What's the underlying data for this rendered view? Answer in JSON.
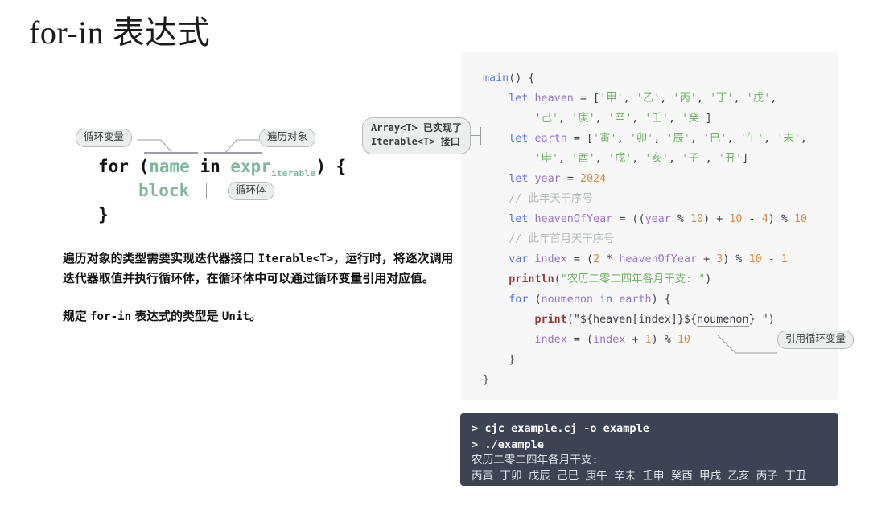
{
  "title": "for-in 表达式",
  "syntax_diagram": {
    "labels": {
      "loop_variable": "循环变量",
      "iteration_object": "遍历对象",
      "loop_body": "循环体"
    },
    "lines": {
      "for_prefix": "for (",
      "name_placeholder": "name",
      "in_keyword": " in ",
      "expr_placeholder": "expr",
      "expr_subscript": "iterable",
      "for_suffix": ") {",
      "block_placeholder": "block",
      "closing_brace": "}"
    }
  },
  "prose": {
    "paragraph1_a": "遍历对象的类型需要实现迭代器接口 ",
    "paragraph1_code": "Iterable<T>",
    "paragraph1_b": "，运行时，将逐次调用迭代器取值并执行循环体，在循环体中可以通过循环变量引用对应值。",
    "paragraph2_a": "规定 ",
    "paragraph2_code1": "for-in",
    "paragraph2_b": " 表达式的类型是 ",
    "paragraph2_code2": "Unit",
    "paragraph2_c": "。"
  },
  "callouts": {
    "array_line1": "Array<T> 已实现了",
    "array_line2": "Iterable<T> 接口",
    "reference_loop_variable": "引用循环变量"
  },
  "code": {
    "lines": [
      {
        "tokens": [
          {
            "t": "main",
            "c": "k-fn"
          },
          {
            "t": "() {",
            "c": "k-plain"
          }
        ]
      },
      {
        "tokens": [
          {
            "t": "    ",
            "c": "k-plain"
          },
          {
            "t": "let",
            "c": "k-kw"
          },
          {
            "t": " ",
            "c": "k-plain"
          },
          {
            "t": "heaven",
            "c": "k-var"
          },
          {
            "t": " = [",
            "c": "k-plain"
          },
          {
            "t": "'甲'",
            "c": "k-str"
          },
          {
            "t": ", ",
            "c": "k-plain"
          },
          {
            "t": "'乙'",
            "c": "k-str"
          },
          {
            "t": ", ",
            "c": "k-plain"
          },
          {
            "t": "'丙'",
            "c": "k-str"
          },
          {
            "t": ", ",
            "c": "k-plain"
          },
          {
            "t": "'丁'",
            "c": "k-str"
          },
          {
            "t": ", ",
            "c": "k-plain"
          },
          {
            "t": "'戊'",
            "c": "k-str"
          },
          {
            "t": ",",
            "c": "k-plain"
          }
        ]
      },
      {
        "tokens": [
          {
            "t": "        ",
            "c": "k-plain"
          },
          {
            "t": "'己'",
            "c": "k-str"
          },
          {
            "t": ", ",
            "c": "k-plain"
          },
          {
            "t": "'庚'",
            "c": "k-str"
          },
          {
            "t": ", ",
            "c": "k-plain"
          },
          {
            "t": "'辛'",
            "c": "k-str"
          },
          {
            "t": ", ",
            "c": "k-plain"
          },
          {
            "t": "'壬'",
            "c": "k-str"
          },
          {
            "t": ", ",
            "c": "k-plain"
          },
          {
            "t": "'癸'",
            "c": "k-str"
          },
          {
            "t": "]",
            "c": "k-plain"
          }
        ]
      },
      {
        "tokens": [
          {
            "t": "    ",
            "c": "k-plain"
          },
          {
            "t": "let",
            "c": "k-kw"
          },
          {
            "t": " ",
            "c": "k-plain"
          },
          {
            "t": "earth",
            "c": "k-var"
          },
          {
            "t": " = [",
            "c": "k-plain"
          },
          {
            "t": "'寅'",
            "c": "k-str"
          },
          {
            "t": ", ",
            "c": "k-plain"
          },
          {
            "t": "'卯'",
            "c": "k-str"
          },
          {
            "t": ", ",
            "c": "k-plain"
          },
          {
            "t": "'辰'",
            "c": "k-str"
          },
          {
            "t": ", ",
            "c": "k-plain"
          },
          {
            "t": "'巳'",
            "c": "k-str"
          },
          {
            "t": ", ",
            "c": "k-plain"
          },
          {
            "t": "'午'",
            "c": "k-str"
          },
          {
            "t": ", ",
            "c": "k-plain"
          },
          {
            "t": "'未'",
            "c": "k-str"
          },
          {
            "t": ",",
            "c": "k-plain"
          }
        ]
      },
      {
        "tokens": [
          {
            "t": "        ",
            "c": "k-plain"
          },
          {
            "t": "'申'",
            "c": "k-str"
          },
          {
            "t": ", ",
            "c": "k-plain"
          },
          {
            "t": "'酉'",
            "c": "k-str"
          },
          {
            "t": ", ",
            "c": "k-plain"
          },
          {
            "t": "'戌'",
            "c": "k-str"
          },
          {
            "t": ", ",
            "c": "k-plain"
          },
          {
            "t": "'亥'",
            "c": "k-str"
          },
          {
            "t": ", ",
            "c": "k-plain"
          },
          {
            "t": "'子'",
            "c": "k-str"
          },
          {
            "t": ", ",
            "c": "k-plain"
          },
          {
            "t": "'丑'",
            "c": "k-str"
          },
          {
            "t": "]",
            "c": "k-plain"
          }
        ]
      },
      {
        "tokens": [
          {
            "t": "    ",
            "c": "k-plain"
          },
          {
            "t": "let",
            "c": "k-kw"
          },
          {
            "t": " ",
            "c": "k-plain"
          },
          {
            "t": "year",
            "c": "k-var"
          },
          {
            "t": " = ",
            "c": "k-plain"
          },
          {
            "t": "2024",
            "c": "k-num"
          }
        ]
      },
      {
        "tokens": [
          {
            "t": "    // 此年天干序号",
            "c": "k-cmt"
          }
        ]
      },
      {
        "tokens": [
          {
            "t": "    ",
            "c": "k-plain"
          },
          {
            "t": "let",
            "c": "k-kw"
          },
          {
            "t": " ",
            "c": "k-plain"
          },
          {
            "t": "heavenOfYear",
            "c": "k-var"
          },
          {
            "t": " = ((",
            "c": "k-plain"
          },
          {
            "t": "year",
            "c": "k-var"
          },
          {
            "t": " % ",
            "c": "k-plain"
          },
          {
            "t": "10",
            "c": "k-num"
          },
          {
            "t": ") + ",
            "c": "k-plain"
          },
          {
            "t": "10",
            "c": "k-num"
          },
          {
            "t": " - ",
            "c": "k-plain"
          },
          {
            "t": "4",
            "c": "k-num"
          },
          {
            "t": ") % ",
            "c": "k-plain"
          },
          {
            "t": "10",
            "c": "k-num"
          }
        ]
      },
      {
        "tokens": [
          {
            "t": "    // 此年首月天干序号",
            "c": "k-cmt"
          }
        ]
      },
      {
        "tokens": [
          {
            "t": "    ",
            "c": "k-plain"
          },
          {
            "t": "var",
            "c": "k-kw"
          },
          {
            "t": " ",
            "c": "k-plain"
          },
          {
            "t": "index",
            "c": "k-var"
          },
          {
            "t": " = (",
            "c": "k-plain"
          },
          {
            "t": "2",
            "c": "k-num"
          },
          {
            "t": " * ",
            "c": "k-plain"
          },
          {
            "t": "heavenOfYear",
            "c": "k-var"
          },
          {
            "t": " + ",
            "c": "k-plain"
          },
          {
            "t": "3",
            "c": "k-num"
          },
          {
            "t": ") % ",
            "c": "k-plain"
          },
          {
            "t": "10",
            "c": "k-num"
          },
          {
            "t": " - ",
            "c": "k-plain"
          },
          {
            "t": "1",
            "c": "k-num"
          }
        ]
      },
      {
        "tokens": [
          {
            "t": "    ",
            "c": "k-plain"
          },
          {
            "t": "println",
            "c": "k-call"
          },
          {
            "t": "(",
            "c": "k-plain"
          },
          {
            "t": "\"农历二零二四年各月干支: \"",
            "c": "k-str"
          },
          {
            "t": ")",
            "c": "k-plain"
          }
        ]
      },
      {
        "tokens": [
          {
            "t": "    ",
            "c": "k-plain"
          },
          {
            "t": "for",
            "c": "k-kw"
          },
          {
            "t": " (",
            "c": "k-plain"
          },
          {
            "t": "noumenon",
            "c": "k-var"
          },
          {
            "t": " ",
            "c": "k-plain"
          },
          {
            "t": "in",
            "c": "k-kw"
          },
          {
            "t": " ",
            "c": "k-plain"
          },
          {
            "t": "earth",
            "c": "k-var"
          },
          {
            "t": ") {",
            "c": "k-plain"
          }
        ]
      },
      {
        "tokens": [
          {
            "t": "        ",
            "c": "k-plain"
          },
          {
            "t": "print",
            "c": "k-call"
          },
          {
            "t": "(",
            "c": "k-plain"
          },
          {
            "t": "\"${heaven[index]}${",
            "c": "k-plain"
          },
          {
            "t": "noumenon",
            "c": "k-plain k-ul"
          },
          {
            "t": "} \"",
            "c": "k-plain"
          },
          {
            "t": ")",
            "c": "k-plain"
          }
        ]
      },
      {
        "tokens": [
          {
            "t": "        ",
            "c": "k-plain"
          },
          {
            "t": "index",
            "c": "k-var"
          },
          {
            "t": " = (",
            "c": "k-plain"
          },
          {
            "t": "index",
            "c": "k-var"
          },
          {
            "t": " + ",
            "c": "k-plain"
          },
          {
            "t": "1",
            "c": "k-num"
          },
          {
            "t": ") % ",
            "c": "k-plain"
          },
          {
            "t": "10",
            "c": "k-num"
          }
        ]
      },
      {
        "tokens": [
          {
            "t": "    }",
            "c": "k-plain"
          }
        ]
      },
      {
        "tokens": [
          {
            "t": "}",
            "c": "k-plain"
          }
        ]
      }
    ]
  },
  "terminal": {
    "lines": [
      {
        "text": "> cjc example.cj -o example",
        "cls": "term-cmd"
      },
      {
        "text": "> ./example",
        "cls": "term-cmd"
      },
      {
        "text": "农历二零二四年各月干支:",
        "cls": "term-out"
      },
      {
        "text": "丙寅 丁卯 戊辰 己巳 庚午 辛未 壬申 癸酉 甲戌 乙亥 丙子 丁丑",
        "cls": "term-out"
      }
    ]
  },
  "colors": {
    "code_card_bg": "#f7f7f8",
    "terminal_bg": "#3c4454",
    "placeholder_green": "#7fb79d",
    "pill_bg": "#eceded",
    "pill_border": "#b9bcbd"
  }
}
